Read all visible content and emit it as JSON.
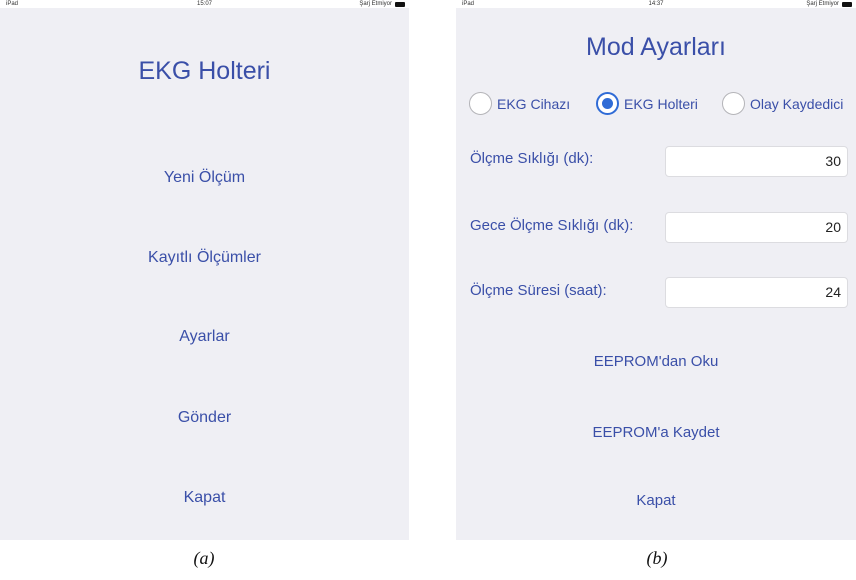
{
  "screen_a": {
    "status": {
      "device": "iPad",
      "time": "15:07",
      "charge": "Şarj Etmiyor"
    },
    "title": "EKG Holteri",
    "menu": [
      "Yeni Ölçüm",
      "Kayıtlı Ölçümler",
      "Ayarlar",
      "Gönder",
      "Kapat"
    ]
  },
  "screen_b": {
    "status": {
      "device": "iPad",
      "time": "14:37",
      "charge": "Şarj Etmiyor"
    },
    "title": "Mod Ayarları",
    "modes": [
      {
        "label": "EKG Cihazı",
        "selected": false
      },
      {
        "label": "EKG Holteri",
        "selected": true
      },
      {
        "label": "Olay Kaydedici",
        "selected": false
      }
    ],
    "fields": [
      {
        "label": "Ölçme Sıklığı (dk):",
        "value": "30"
      },
      {
        "label": "Gece Ölçme Sıklığı (dk):",
        "value": "20"
      },
      {
        "label": "Ölçme Süresi (saat):",
        "value": "24"
      }
    ],
    "buttons": [
      "EEPROM'dan Oku",
      "EEPROM'a Kaydet",
      "Kapat"
    ]
  },
  "captions": {
    "a": "(a)",
    "b": "(b)"
  },
  "colors": {
    "accent": "#3a4fa8",
    "radio_selected": "#2f6bd6",
    "background": "#efeff4"
  },
  "icons": {
    "battery": "battery-icon"
  }
}
